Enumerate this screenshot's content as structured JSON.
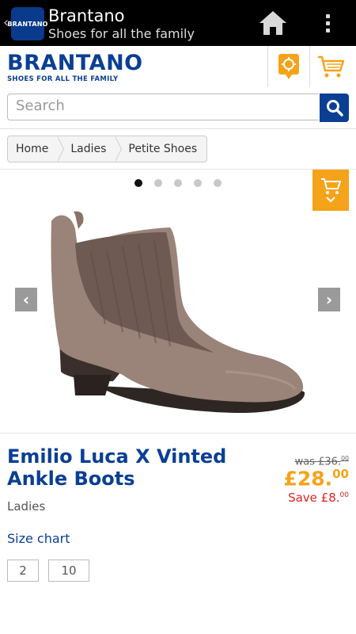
{
  "appbar": {
    "logo_text": "BRANTANO",
    "title": "Brantano",
    "subtitle": "Shoes for all the family",
    "icons": [
      "chevron-left-icon",
      "home-icon",
      "overflow-menu-icon"
    ]
  },
  "header": {
    "brand_name": "BRANTANO",
    "brand_tagline": "SHOES FOR ALL THE FAMILY",
    "icons": [
      "store-locator-icon",
      "cart-icon"
    ],
    "accent_color": "#f5a31a",
    "brand_color": "#0a3f93"
  },
  "search": {
    "placeholder": "Search",
    "button_icon": "search-icon"
  },
  "breadcrumb": [
    "Home",
    "Ladies",
    "Petite Shoes"
  ],
  "gallery": {
    "image_count": 5,
    "active_index": 0,
    "prev_label": "‹",
    "next_label": "›",
    "quick_cart_icon": "cart-icon"
  },
  "product": {
    "name": "Emilio Luca X Vinted Ankle Boots",
    "category": "Ladies",
    "was_label": "was £36.",
    "was_pence": "00",
    "price_main": "£28.",
    "price_pence": "00",
    "save_label": "Save £8.",
    "save_pence": "00",
    "size_chart_label": "Size chart",
    "sizes": [
      "2",
      "10"
    ]
  }
}
